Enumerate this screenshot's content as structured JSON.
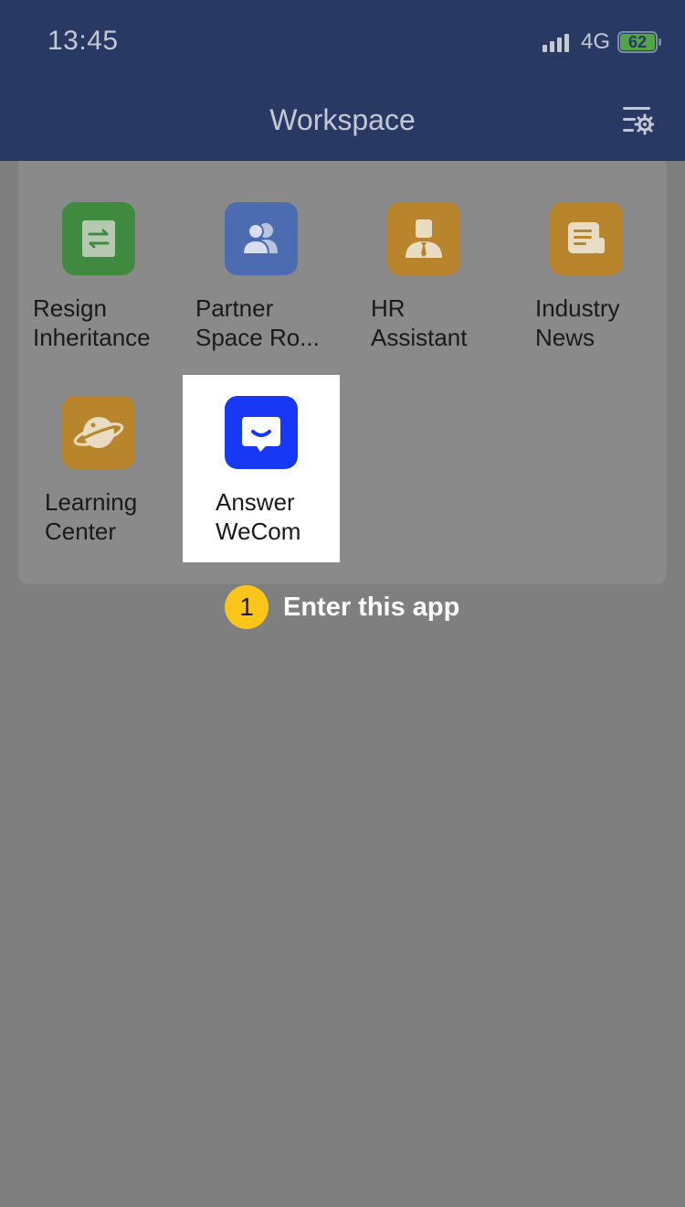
{
  "status_bar": {
    "time": "13:45",
    "network": "4G",
    "battery": "62"
  },
  "header": {
    "title": "Workspace",
    "settings_icon": "list-settings-icon"
  },
  "apps": [
    {
      "line1": "Resign",
      "line2": "Inheritance",
      "icon": "transfer-document-icon",
      "color": "#3f8a3f"
    },
    {
      "line1": "Partner",
      "line2": "Space Ro...",
      "icon": "users-icon",
      "color": "#4c6bb1"
    },
    {
      "line1": "HR",
      "line2": "Assistant",
      "icon": "person-tie-icon",
      "color": "#b8852c"
    },
    {
      "line1": "Industry",
      "line2": "News",
      "icon": "news-icon",
      "color": "#b8852c"
    },
    {
      "line1": "Learning",
      "line2": "Center",
      "icon": "planet-icon",
      "color": "#b8852c"
    },
    {
      "line1": "Answer",
      "line2": "WeCom",
      "icon": "chat-bubble-icon",
      "color": "#1739f5"
    }
  ],
  "instruction": {
    "step_number": "1",
    "text": "Enter this app"
  },
  "colors": {
    "header_bg": "#283964",
    "overlay": "#7f7f80",
    "step_badge": "#fbc51a"
  }
}
